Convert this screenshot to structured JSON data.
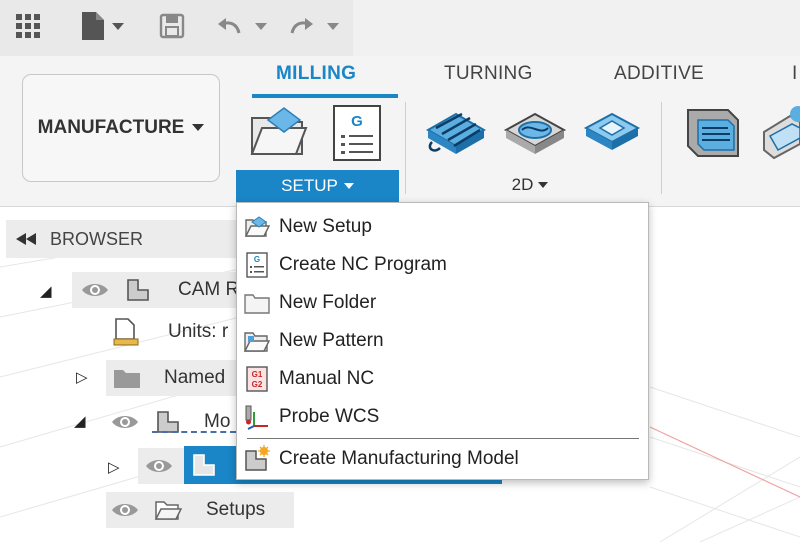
{
  "toolbar": {
    "icons": [
      "grid-icon",
      "file-icon",
      "save-icon",
      "undo-icon",
      "redo-icon"
    ]
  },
  "ribbon": {
    "workspace": "MANUFACTURE",
    "tabs": [
      {
        "label": "MILLING",
        "active": true
      },
      {
        "label": "TURNING",
        "active": false
      },
      {
        "label": "ADDITIVE",
        "active": false
      },
      {
        "label": "I",
        "active": false
      }
    ],
    "groups": {
      "setup": "SETUP",
      "twod": "2D"
    }
  },
  "browser": {
    "title": "BROWSER",
    "rows": [
      {
        "label": "CAM R",
        "expanded": true
      },
      {
        "label": "Units: r"
      },
      {
        "label": "Named",
        "expanded": false
      },
      {
        "label": "Mo",
        "expanded": true
      },
      {
        "label": "",
        "selected": true
      },
      {
        "label": "Setups"
      }
    ]
  },
  "menu": {
    "items": [
      {
        "label": "New Setup",
        "icon": "new-setup-icon"
      },
      {
        "label": "Create NC Program",
        "icon": "nc-program-icon"
      },
      {
        "label": "New Folder",
        "icon": "folder-icon"
      },
      {
        "label": "New Pattern",
        "icon": "pattern-icon"
      },
      {
        "label": "Manual NC",
        "icon": "manual-nc-icon"
      },
      {
        "label": "Probe WCS",
        "icon": "probe-wcs-icon"
      },
      {
        "label": "Create Manufacturing Model",
        "icon": "manufacturing-model-icon"
      }
    ],
    "icon_text": {
      "nc": "G",
      "manual1": "G1",
      "manual2": "G2"
    }
  },
  "colors": {
    "accent": "#1a86c7",
    "toolbar_bg": "#e9e9e9",
    "ribbon_bg": "#f4f4f4",
    "selection": "#1a86c7"
  }
}
